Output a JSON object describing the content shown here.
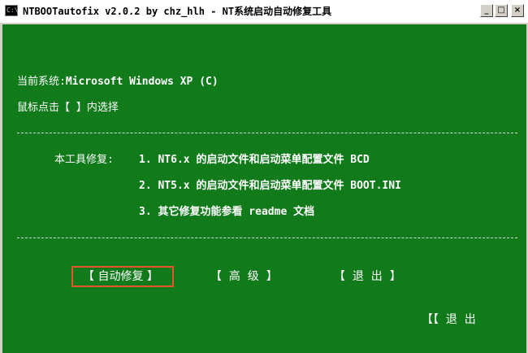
{
  "window": {
    "title": "NTBOOTautofix v2.0.2 by chz_hlh - NT系统启动自动修复工具",
    "icon_label": "C:\\",
    "minimize_label": "_",
    "maximize_label": "□",
    "close_label": "×"
  },
  "console": {
    "current_system_label": "当前系统:",
    "current_system_value": "Microsoft Windows XP  (C)",
    "instruction": "鼠标点击【 】内选择",
    "repair_heading": "本工具修复:",
    "items": [
      "1. NT6.x 的启动文件和启动菜单配置文件 BCD",
      "2. NT5.x 的启动文件和启动菜单配置文件 BOOT.INI",
      "3. 其它修复功能参看 readme 文档"
    ],
    "buttons": {
      "auto_repair": "【 自动修复 】",
      "advanced": "【  高  级  】",
      "exit": "【  退  出  】",
      "exit_corner": "【【  退  出"
    }
  },
  "colors": {
    "console_bg": "#117a1a",
    "selected_border": "#e8552d"
  }
}
